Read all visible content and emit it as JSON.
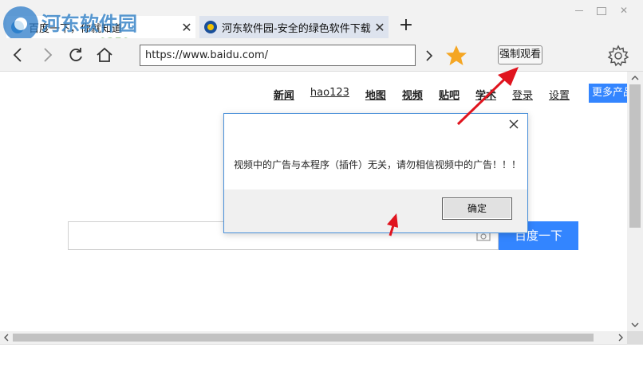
{
  "watermark": {
    "name": "河东软件园",
    "url": "www.pc0359.cn"
  },
  "tabs": [
    {
      "title": "百度一下，你就知道",
      "icon": "paw-icon",
      "active": true
    },
    {
      "title": "河东软件园-安全的绿色软件下载站",
      "icon": "hedong-logo-icon",
      "active": false
    }
  ],
  "new_tab_label": "+",
  "toolbar": {
    "address": "https://www.baidu.com/",
    "force_watch_label": "强制观看"
  },
  "page": {
    "top_links": [
      {
        "label": "新闻",
        "bold": true
      },
      {
        "label": "hao123",
        "bold": false
      },
      {
        "label": "地图",
        "bold": true
      },
      {
        "label": "视频",
        "bold": true
      },
      {
        "label": "贴吧",
        "bold": true
      },
      {
        "label": "学术",
        "bold": true
      },
      {
        "label": "登录",
        "bold": false
      },
      {
        "label": "设置",
        "bold": false
      }
    ],
    "more_products": "更多产品",
    "search_button": "百度一下",
    "search_value": ""
  },
  "dialog": {
    "message": "视频中的广告与本程序（插件）无关，请勿相信视频中的广告！！！",
    "ok_label": "确定"
  },
  "colors": {
    "accent_blue": "#3385ff",
    "dialog_border": "#4a90d9",
    "annotation_red": "#e0141e",
    "star": "#f5a623"
  }
}
